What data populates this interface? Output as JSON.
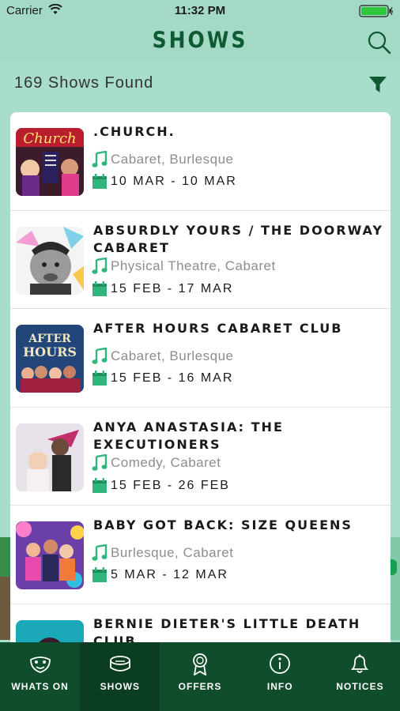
{
  "status_bar": {
    "carrier": "Carrier",
    "time": "11:32 PM"
  },
  "nav": {
    "title": "SHOWS"
  },
  "results": {
    "count_label": "169 Shows Found"
  },
  "shows": [
    {
      "title": ".CHURCH.",
      "genres": "Cabaret, Burlesque",
      "dates": "10 MAR - 10 MAR",
      "thumb": "church"
    },
    {
      "title": "ABSURDLY YOURS / THE DOORWAY CABARET",
      "genres": "Physical Theatre, Cabaret",
      "dates": "15 FEB - 17 MAR",
      "thumb": "absurdly"
    },
    {
      "title": "AFTER HOURS CABARET CLUB",
      "genres": "Cabaret, Burlesque",
      "dates": "15 FEB - 16 MAR",
      "thumb": "afterhours"
    },
    {
      "title": "ANYA ANASTASIA: THE EXECUTIONERS",
      "genres": "Comedy, Cabaret",
      "dates": "15 FEB - 26 FEB",
      "thumb": "anya"
    },
    {
      "title": "BABY GOT BACK: SIZE QUEENS",
      "genres": "Burlesque, Cabaret",
      "dates": "5 MAR - 12 MAR",
      "thumb": "baby"
    },
    {
      "title": "BERNIE DIETER'S LITTLE DEATH CLUB",
      "genres": "",
      "dates": "",
      "thumb": "bernie"
    }
  ],
  "tabs": [
    {
      "label": "WHATS ON",
      "icon": "masks-icon",
      "active": false
    },
    {
      "label": "SHOWS",
      "icon": "ticket-icon",
      "active": true
    },
    {
      "label": "OFFERS",
      "icon": "award-icon",
      "active": false
    },
    {
      "label": "INFO",
      "icon": "info-icon",
      "active": false
    },
    {
      "label": "NOTICES",
      "icon": "bell-icon",
      "active": false
    }
  ],
  "colors": {
    "brand_green": "#0e5a33",
    "mint": "#a8dccb",
    "accent_icon": "#2fb67a",
    "tab_bar": "#0f4d2c"
  }
}
